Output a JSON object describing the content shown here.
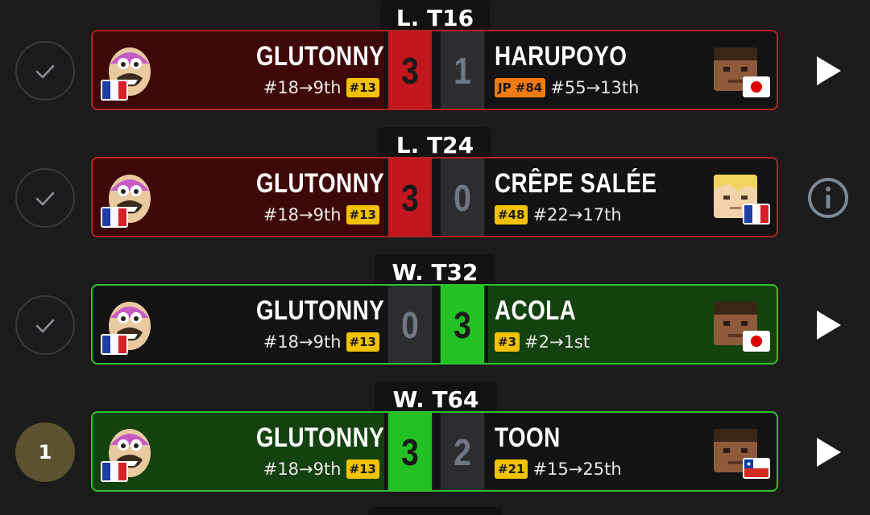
{
  "matches": [
    {
      "round": "L. T16",
      "status": "check",
      "status_text": "",
      "result": "loss",
      "left": {
        "name": "GLUTONNY",
        "seed": "#18→9th",
        "badge": "#13",
        "flag": "fr",
        "score": "3"
      },
      "right": {
        "name": "HARUPOYO",
        "badge": "JP #84",
        "badge_type": "jp",
        "seed": "#55→13th",
        "flag": "jp",
        "score": "1"
      },
      "action_icon": "play-icon"
    },
    {
      "round": "L. T24",
      "status": "check",
      "status_text": "",
      "result": "loss",
      "left": {
        "name": "GLUTONNY",
        "seed": "#18→9th",
        "badge": "#13",
        "flag": "fr",
        "score": "3"
      },
      "right": {
        "name": "CRÊPE SALÉE",
        "badge": "#48",
        "badge_type": "yellow",
        "seed": "#22→17th",
        "flag": "fr",
        "score": "0"
      },
      "action_icon": "info-icon"
    },
    {
      "round": "W. T32",
      "status": "check",
      "status_text": "",
      "result": "win-right",
      "left": {
        "name": "GLUTONNY",
        "seed": "#18→9th",
        "badge": "#13",
        "flag": "fr",
        "score": "0"
      },
      "right": {
        "name": "ACOLA",
        "badge": "#3",
        "badge_type": "yellow",
        "seed": "#2→1st",
        "flag": "jp",
        "score": "3"
      },
      "action_icon": "play-icon"
    },
    {
      "round": "W. T64",
      "status": "number",
      "status_text": "1",
      "result": "win-left",
      "left": {
        "name": "GLUTONNY",
        "seed": "#18→9th",
        "badge": "#13",
        "flag": "fr",
        "score": "3"
      },
      "right": {
        "name": "TOON",
        "badge": "#21",
        "badge_type": "yellow",
        "seed": "#15→25th",
        "flag": "cl",
        "score": "2"
      },
      "action_icon": "play-icon"
    }
  ],
  "colors": {
    "loss_border": "#b22222",
    "win_border": "#2ec22e",
    "winner_score": "#24c124",
    "loser_score_red": "#c1171d",
    "badge_yellow": "#f2c200",
    "badge_orange": "#f07a10"
  }
}
